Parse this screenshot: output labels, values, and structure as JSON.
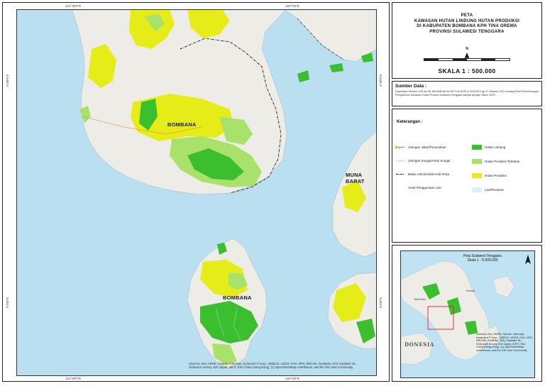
{
  "map": {
    "ticks_top": [
      "121°30'0\"E",
      "122°0'0\"E"
    ],
    "ticks_bottom": [
      "121°30'0\"E",
      "122°0'0\"E"
    ],
    "ticks_left": [
      "4°30'0\"S",
      "5°0'0\"S"
    ],
    "ticks_right": [
      "4°30'0\"S",
      "5°0'0\"S"
    ],
    "labels": {
      "bombana_north": "BOMBANA",
      "bombana_south": "BOMBANA",
      "muna_barat": "MUNA BARAT"
    },
    "attribution": "Sources: Esri, HERE, Garmin, Intermap, increment P Corp., GEBCO, USGS, FAO, NPS, NRCAN, GeoBase, IGN, Kadaster NL, Ordnance Survey, Esri Japan, METI, Esri China (Hong Kong), (c) OpenStreetMap contributors, and the GIS User Community"
  },
  "title": {
    "line1": "PETA",
    "line2": "KAWASAN HUTAN LINDUNG HUTAN PRODUKSI",
    "line3": "DI KABUPATEN BOMBANA KPH TINA OREMA",
    "line4": "PROVINSI  SULAWESI TENGGARA",
    "north_letter": "N",
    "scale": "SKALA  1  :  500.000"
  },
  "source": {
    "title": "Sumber Data :",
    "body": "Keputusan Menteri LHK No SK.8623/MENLHK-PKTL/KUH/PLA.2/10/2021 tgl 27 Oktober 2021 tentang Peta Perkembangan Pengukuhan Kawasan Hutan Provinsi Sulawesi Tenggara sampai dengan Tahun 2020"
  },
  "legend": {
    "title": "Keterangan  :",
    "items": [
      {
        "label": "Jaringan Jalan/Perumahan",
        "symbol": "road",
        "color": "#e8732a"
      },
      {
        "label": "Jaringan Sungai/Anak Sungai",
        "symbol": "river",
        "color": "#9fe4f5"
      },
      {
        "label": "Batas Administrasi Kab./Kota",
        "symbol": "boundary",
        "color": "#111111"
      },
      {
        "label": "Areal Penggunaan Lain",
        "symbol": "none",
        "color": "#ffffff"
      },
      {
        "label": "Hutan Lindung",
        "symbol": "fill",
        "color": "#3bbf2e"
      },
      {
        "label": "Hutan Produksi Terbatas",
        "symbol": "fill",
        "color": "#a8e26a"
      },
      {
        "label": "Hutan Produksi",
        "symbol": "fill",
        "color": "#e6ec18"
      },
      {
        "label": "Laut/Perairan",
        "symbol": "fill",
        "color": "#d6f4f1"
      }
    ]
  },
  "inset": {
    "title_line1": "Peta Sulawesi Tenggara",
    "title_line2": "Skala 1 : 5.000.000",
    "label_kendari": "Kendari",
    "label_bone": "Teluk Bone",
    "label_nesia": "DONESIA",
    "attribution": "Sources: Esri, HERE, Garmin, Intermap, increment P Corp., GEBCO, USGS, FAO, NPS, NRCAN, GeoBase, IGN, Kadaster NL, Ordnance Survey, Esri Japan, METI, Esri China (Hong Kong), (c) OpenStreetMap contributors, and the GIS User Community"
  },
  "colors": {
    "sea": "#b9dff0",
    "land": "#eeece6",
    "hutan_lindung": "#3bbf2e",
    "hutan_produksi_terbatas": "#a8e26a",
    "hutan_produksi": "#e6ec18"
  }
}
